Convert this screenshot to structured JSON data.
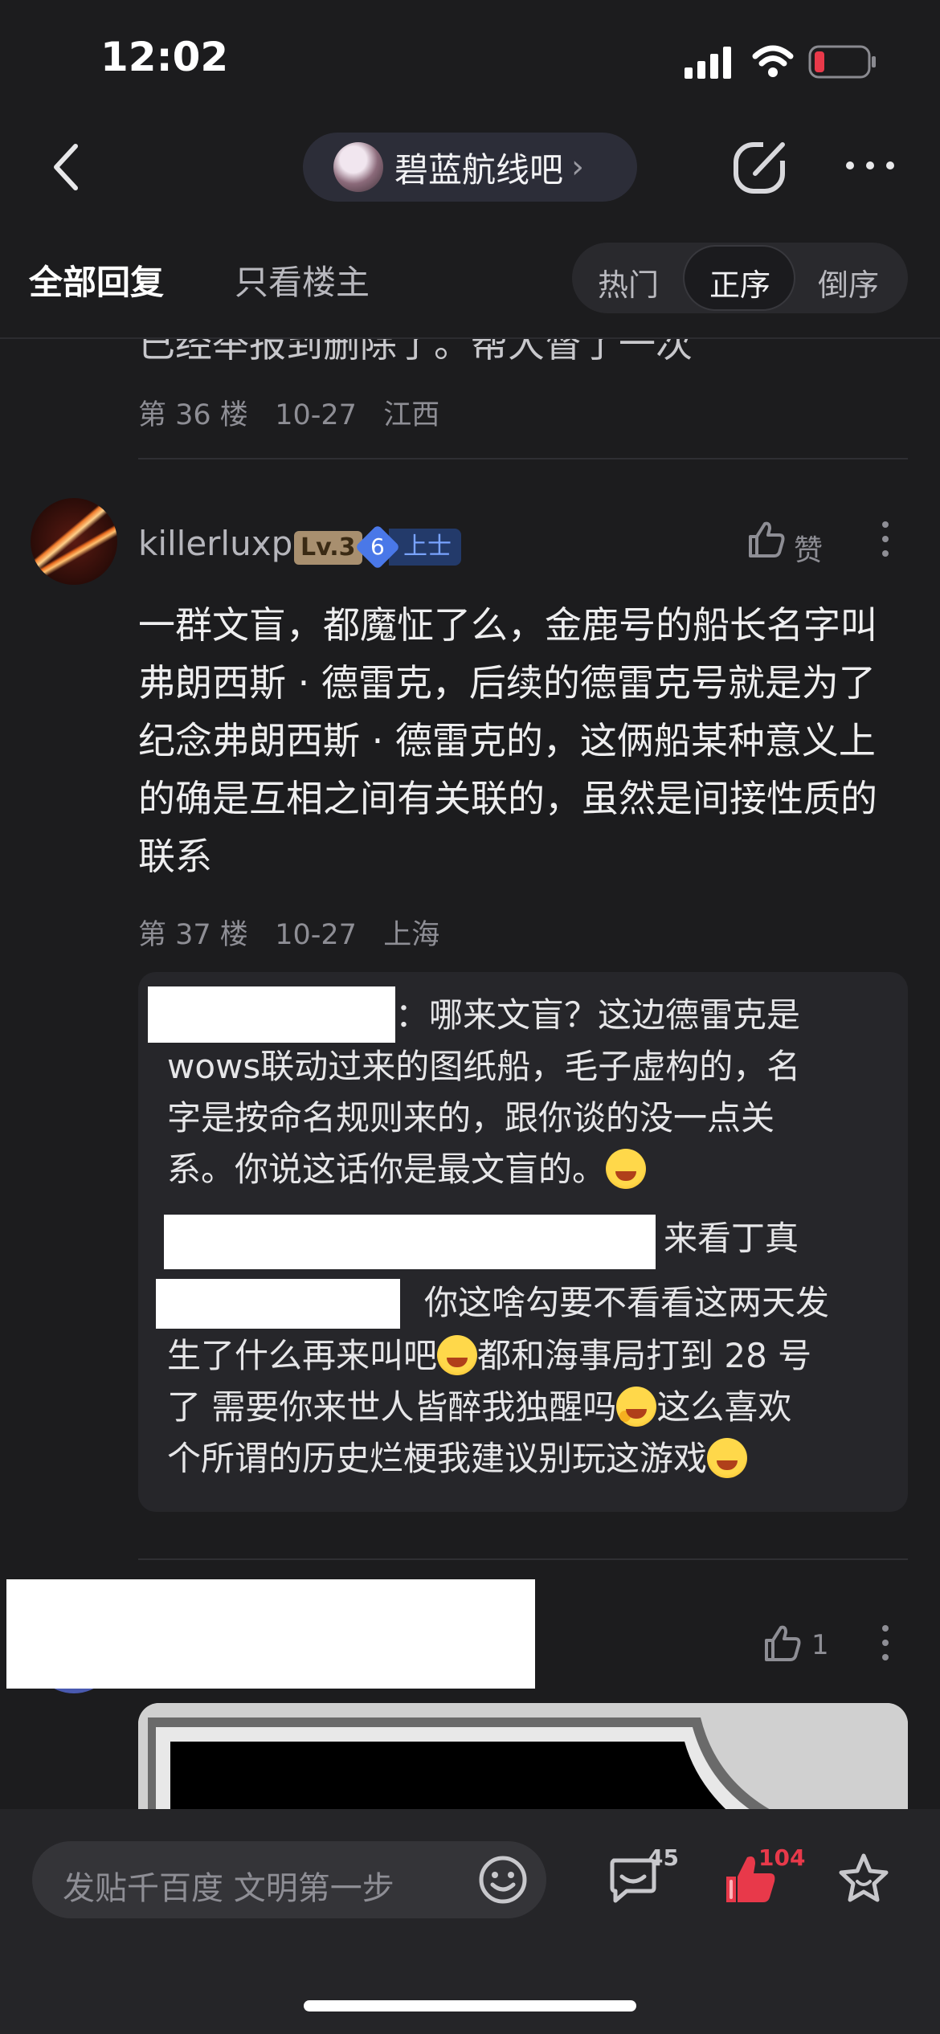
{
  "status_bar": {
    "time": "12:02"
  },
  "nav": {
    "forum_name": "碧蓝航线吧",
    "chevron": "›"
  },
  "tabs": {
    "all_replies": "全部回复",
    "op_only": "只看楼主"
  },
  "sort": {
    "hot": "热门",
    "ascending": "正序",
    "descending": "倒序",
    "selected": "正序"
  },
  "previous_post": {
    "partial_text": "已经举报到删除了。帮大督了一次",
    "floor": "第 36 楼",
    "date": "10-27",
    "location": "江西"
  },
  "post": {
    "username": "killerluxp",
    "level": "Lv.3",
    "rank_number": "6",
    "rank_title": "上士",
    "like_label": "赞",
    "body": "一群文盲，都魔怔了么，金鹿号的船长名字叫弗朗西斯 · 德雷克，后续的德雷克号就是为了纪念弗朗西斯 · 德雷克的，这俩船某种意义上的确是互相之间有关联的，虽然是间接性质的联系",
    "floor": "第 37 楼",
    "date": "10-27",
    "location": "上海"
  },
  "replies": [
    {
      "text_lines": [
        "：哪来文盲？这边德雷克是",
        "wows联动过来的图纸船，毛子虚构的，名",
        "字是按命名规则来的，跟你谈的没一点关",
        "系。你说这话你是最文盲的。"
      ]
    },
    {
      "text": "来看丁真"
    },
    {
      "text_lines": [
        "你这啥勾要不看看这两天发",
        "生了什么再来叫吧",
        "都和海事局打到 28 号",
        "了 需要你来世人皆醉我独醒吗",
        "这么喜欢",
        "个所谓的历史烂梗我建议别玩这游戏"
      ]
    }
  ],
  "next_post": {
    "like_count": "1"
  },
  "bottom_bar": {
    "compose_placeholder": "发贴千百度 文明第一步",
    "comment_count": "45",
    "like_count": "104"
  },
  "icons": [
    "back-icon",
    "share-icon",
    "more-icon",
    "like-icon",
    "emoji-icon",
    "comment-icon",
    "thumb-up-icon",
    "star-icon",
    "signal-icon",
    "wifi-icon",
    "battery-icon"
  ],
  "colors": {
    "background": "#1c1c1e",
    "accent_red": "#e8394a",
    "rank_blue": "#4a78e8"
  }
}
